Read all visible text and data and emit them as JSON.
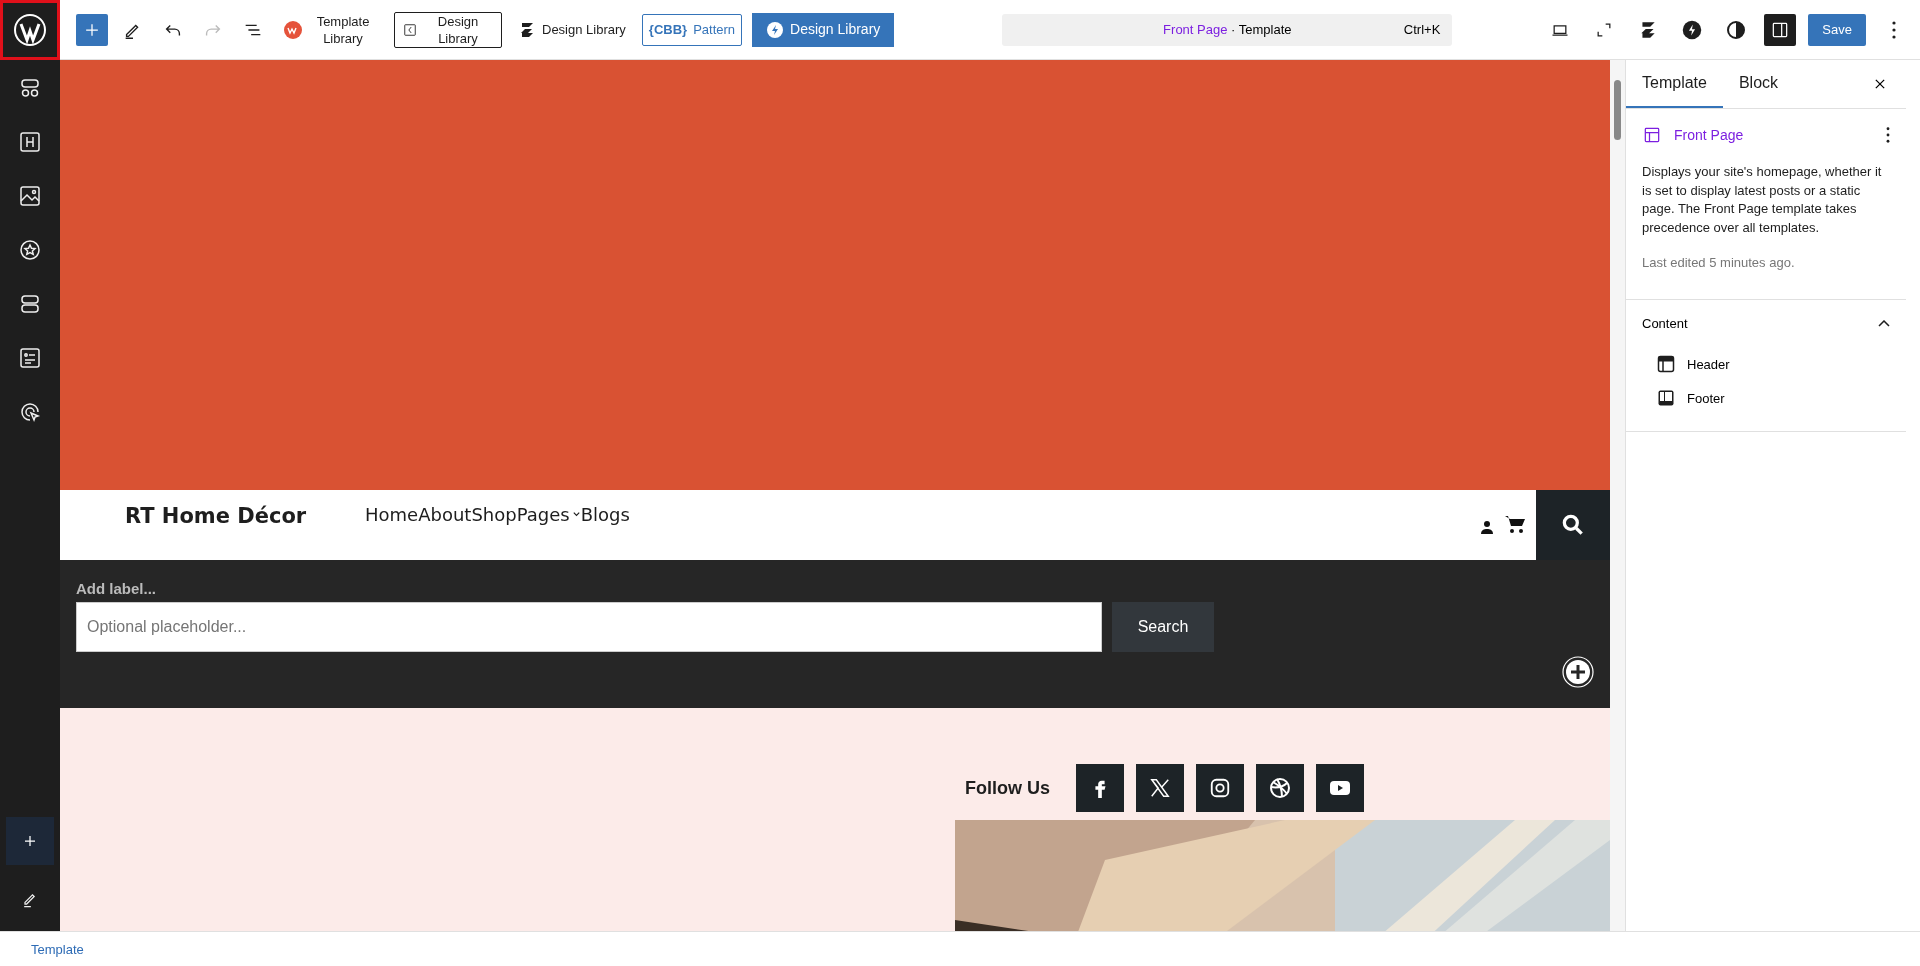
{
  "toolbar": {
    "library_buttons": [
      {
        "kind": "wl",
        "label": "Template Library"
      },
      {
        "kind": "boxed",
        "label": "Design Library"
      },
      {
        "kind": "stack",
        "label": "Design Library"
      },
      {
        "kind": "cbb",
        "logo_text": "{CBB}",
        "label": "Pattern"
      },
      {
        "kind": "primary",
        "label": "Design Library"
      }
    ],
    "command_bar": {
      "title": "Front Page",
      "suffix": " · Template",
      "shortcut": "Ctrl+K"
    },
    "settings_open": true,
    "save_label": "Save"
  },
  "canvas": {
    "site_title": "RT Home Décor",
    "nav": [
      {
        "label": "Home",
        "has_submenu": false
      },
      {
        "label": "About",
        "has_submenu": false
      },
      {
        "label": "Shop",
        "has_submenu": false
      },
      {
        "label": "Pages",
        "has_submenu": true
      },
      {
        "label": "Blogs",
        "has_submenu": false
      }
    ],
    "search": {
      "label": "Add label...",
      "placeholder": "Optional placeholder...",
      "button": "Search"
    },
    "follow_label": "Follow Us",
    "social": [
      {
        "kind": "facebook"
      },
      {
        "kind": "x"
      },
      {
        "kind": "instagram"
      },
      {
        "kind": "dribbble"
      },
      {
        "kind": "youtube"
      }
    ]
  },
  "settings_panel": {
    "tabs": [
      {
        "label": "Template",
        "selected": true
      },
      {
        "label": "Block",
        "selected": false
      }
    ],
    "template_name": "Front Page",
    "description": "Displays your site's homepage, whether it is set to display latest posts or a static page. The Front Page template takes precedence over all templates.",
    "last_edited": "Last edited 5 minutes ago.",
    "content": {
      "title": "Content",
      "expanded": true,
      "items": [
        {
          "kind": "header",
          "label": "Header"
        },
        {
          "kind": "footer",
          "label": "Footer"
        }
      ]
    }
  },
  "status_bar": {
    "breadcrumb": "Template"
  }
}
